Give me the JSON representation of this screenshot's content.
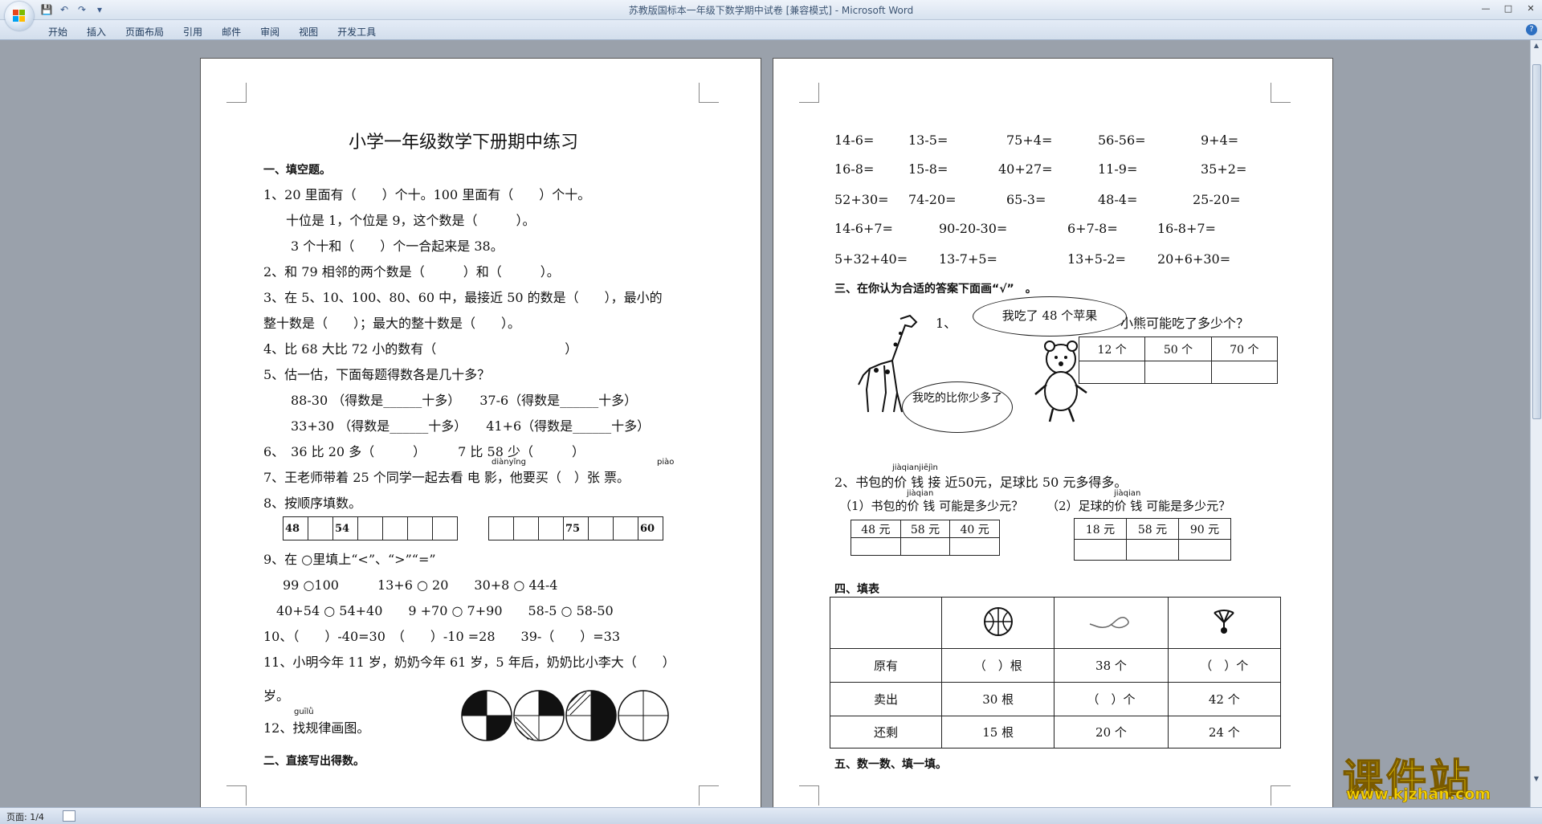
{
  "window": {
    "title": "苏教版国标本一年级下数学期中试卷 [兼容模式] - Microsoft Word",
    "controls": [
      "—",
      "□",
      "✕"
    ]
  },
  "ribbon": {
    "tabs": [
      "开始",
      "插入",
      "页面布局",
      "引用",
      "邮件",
      "审阅",
      "视图",
      "开发工具"
    ]
  },
  "status": {
    "page": "页面: 1/4"
  },
  "page1": {
    "title": "小学一年级数学下册期中练习",
    "section1": "一、填空题。",
    "q1a": "1、20 里面有（　　）个十。100 里面有（　　）个十。",
    "q1b": "十位是 1，个位是 9，这个数是（　　　）。",
    "q1c": "3 个十和（　　）个一合起来是 38。",
    "q2": "2、和 79 相邻的两个数是（　　　）和（　　　）。",
    "q3a": "3、在 5、10、100、80、60 中，最接近 50 的数是（　　），最小的",
    "q3b": "整十数是（　　）；最大的整十数是（　　）。",
    "q4": "4、比 68 大比 72 小的数有（　　　　　　　　　　）",
    "q5": "5、估一估，下面每题得数各是几十多？",
    "q5a": "88-30 （得数是______十多）　　37-6（得数是______十多）",
    "q5b": "33+30 （得数是______十多）　　41+6（得数是______十多）",
    "q6": "6、　36 比 20 多（　　　）　　　7 比 58 少（　　　）",
    "q7": "7、王老师带着 25 个同学一起去看 电 影，他要买（　）张 票。",
    "q7_pinyin1": "diànyǐng",
    "q7_pinyin2": "piào",
    "q8": "8、按顺序填数。",
    "q8_seq1": [
      "48",
      "",
      "54",
      "",
      "",
      "",
      "",
      ""
    ],
    "q8_seq2": [
      "",
      "",
      "",
      "75",
      "",
      "",
      "60",
      ""
    ],
    "q9": "9、在 ○里填上“<”、“>”“=”",
    "q9a": "99 ○100　　　13+6 ○ 20　　30+8 ○ 44-4",
    "q9b": "40+54 ○ 54+40　　9 +70 ○ 7+90　　58-5 ○ 58-50",
    "q10": "10、（　　）-40=30　（　　）-10 =28　　39-（　　）=33",
    "q11a": "11、小明今年 11 岁，奶奶今年 61 岁，5 年后，奶奶比小李大（　　）",
    "q11b": "岁。",
    "q12": "12、找规律画图。",
    "q12_pinyin": "guīlǜ",
    "section2": "二、直接写出得数。"
  },
  "page2": {
    "calc_rows": [
      [
        "14-6=",
        "13-5=",
        "75+4=",
        "56-56=",
        "9+4="
      ],
      [
        "16-8=",
        "15-8=",
        "40+27=",
        "11-9=",
        "35+2="
      ],
      [
        "52+30=",
        "74-20=",
        "65-3=",
        "48-4=",
        "25-20="
      ],
      [
        "14-6+7=",
        "90-20-30=",
        "6+7-8=",
        "16-8+7="
      ],
      [
        "5+32+40=",
        "13-7+5=",
        "13+5-2=",
        "20+6+30="
      ]
    ],
    "section3": "三、在你认为合适的答案下面画“√”　。",
    "q3_1_num": "1、",
    "q3_1_text": "小熊可能吃了多少个？",
    "bubble_giraffe": "我吃了 48 个苹果",
    "bubble_bear": "我吃的比你少多了",
    "q3_1_options": [
      "12 个",
      "50 个",
      "70 个"
    ],
    "q3_2": "2、书包的价 钱 接 近50元，足球比 50 元多得多。",
    "q3_2_pinyin": "jiàqianjiējìn",
    "q3_2a": "（1）书包的价 钱 可能是多少元？",
    "q3_2b": "（2）足球的价 钱 可能是多少元？",
    "q3_2_pinyin_short": "jiàqian",
    "q3_2a_options": [
      "48 元",
      "58 元",
      "40 元"
    ],
    "q3_2b_options": [
      "18 元",
      "58 元",
      "90 元"
    ],
    "section4": "四、填表",
    "table4": {
      "rows": [
        [
          "原有",
          "（　）根",
          "38 个",
          "（　）个"
        ],
        [
          "卖出",
          "30 根",
          "（　）个",
          "42 个"
        ],
        [
          "还剩",
          "15 根",
          "20 个",
          "24 个"
        ]
      ]
    },
    "section5": "五、数一数、填一填。"
  },
  "watermark": {
    "name": "课件站",
    "url": "www.kjzhan.com"
  }
}
